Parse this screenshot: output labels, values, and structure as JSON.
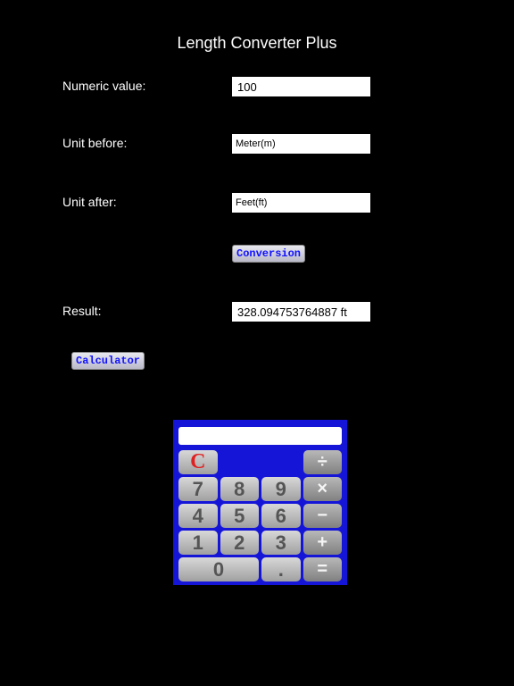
{
  "title": "Length Converter Plus",
  "fields": {
    "numeric_label": "Numeric value:",
    "numeric_value": "100",
    "unit_before_label": "Unit before:",
    "unit_before_value": "Meter(m)",
    "unit_after_label": "Unit after:",
    "unit_after_value": "Feet(ft)",
    "result_label": "Result:",
    "result_value": "328.094753764887 ft"
  },
  "buttons": {
    "conversion": "Conversion",
    "calculator": "Calculator"
  },
  "calc": {
    "clear": "C",
    "divide": "÷",
    "multiply": "×",
    "minus": "−",
    "plus": "+",
    "equals": "=",
    "n7": "7",
    "n8": "8",
    "n9": "9",
    "n4": "4",
    "n5": "5",
    "n6": "6",
    "n1": "1",
    "n2": "2",
    "n3": "3",
    "n0": "0",
    "dot": "."
  }
}
